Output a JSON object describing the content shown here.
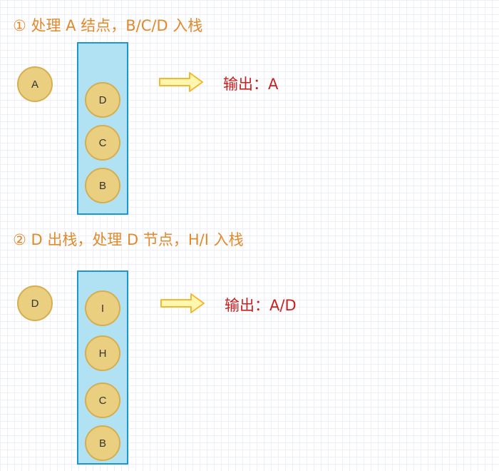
{
  "steps": [
    {
      "title": "① 处理 A 结点，B/C/D 入栈",
      "current": "A",
      "stack": [
        "D",
        "C",
        "B"
      ],
      "output": "输出：A"
    },
    {
      "title": "② D 出栈，处理 D 节点，H/I 入栈",
      "current": "D",
      "stack": [
        "I",
        "H",
        "C",
        "B"
      ],
      "output": "输出：A/D"
    }
  ],
  "colors": {
    "title": "#e08a2c",
    "output": "#cc1f1f",
    "node_fill": "#e9cf7f",
    "node_border": "#d5ae4f",
    "stack_fill": "#b1e2f3",
    "stack_border": "#1b97cf",
    "arrow_fill": "#fff6b0",
    "arrow_stroke": "#f2b830"
  }
}
